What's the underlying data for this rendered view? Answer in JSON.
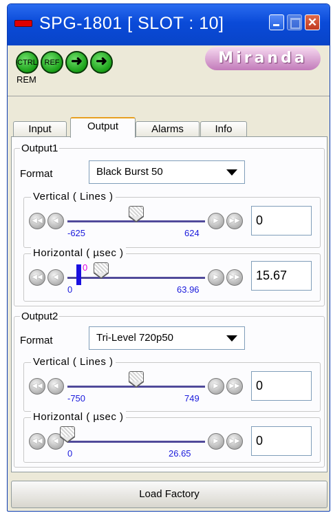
{
  "window": {
    "title": "SPG-1801 [ SLOT : 10]"
  },
  "header": {
    "icons": [
      {
        "name": "ctrl-icon",
        "label": "CTRL"
      },
      {
        "name": "ref-icon",
        "label": "REF"
      },
      {
        "name": "arrow-right-icon",
        "label": ""
      },
      {
        "name": "arrow-right-icon",
        "label": ""
      }
    ],
    "rem": "REM",
    "logo": "Miranda"
  },
  "tabs": [
    {
      "label": "Input"
    },
    {
      "label": "Output"
    },
    {
      "label": "Alarms"
    },
    {
      "label": "Info"
    }
  ],
  "output1": {
    "title": "Output1",
    "format_label": "Format",
    "format_value": "Black Burst 50",
    "vertical": {
      "title": "Vertical ( Lines )",
      "min": "-625",
      "max": "624",
      "value": "0",
      "position": 0.5
    },
    "horizontal": {
      "title": "Horizontal ( µsec )",
      "min": "0",
      "max": "63.96",
      "value": "15.67",
      "position": 0.245,
      "marker_value": "0"
    }
  },
  "output2": {
    "title": "Output2",
    "format_label": "Format",
    "format_value": "Tri-Level 720p50",
    "vertical": {
      "title": "Vertical ( Lines )",
      "min": "-750",
      "max": "749",
      "value": "0",
      "position": 0.5
    },
    "horizontal": {
      "title": "Horizontal ( µsec )",
      "min": "0",
      "max": "26.65",
      "value": "0",
      "position": 0.0
    }
  },
  "footer": {
    "button_label": "Load Factory"
  }
}
